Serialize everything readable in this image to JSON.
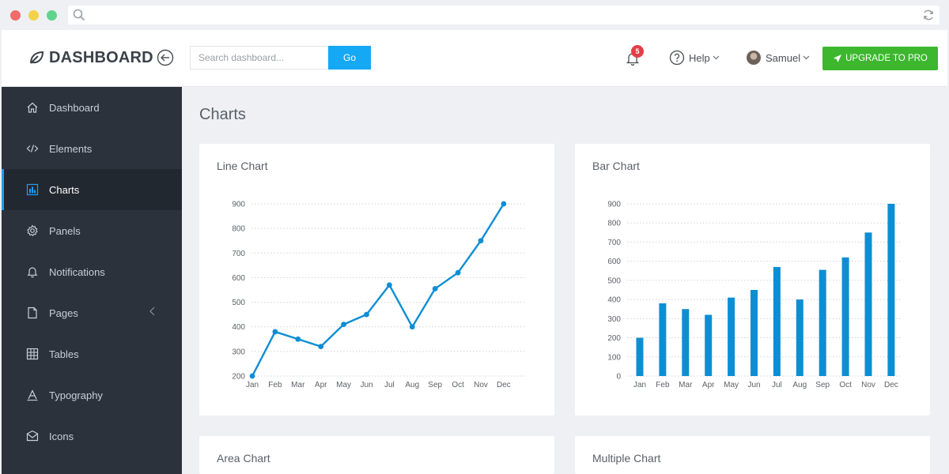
{
  "browser": {
    "icons": {
      "search": "search-icon",
      "reload": "reload-icon"
    }
  },
  "header": {
    "brand": "DASHBOARD",
    "search_placeholder": "Search dashboard...",
    "go_label": "Go",
    "notification_count": "5",
    "help_label": "Help",
    "user_name": "Samuel",
    "upgrade_label": "UPGRADE TO PRO"
  },
  "sidebar": {
    "items": [
      {
        "label": "Dashboard",
        "icon": "home-icon"
      },
      {
        "label": "Elements",
        "icon": "code-icon"
      },
      {
        "label": "Charts",
        "icon": "bar-chart-icon",
        "active": true
      },
      {
        "label": "Panels",
        "icon": "gear-icon"
      },
      {
        "label": "Notifications",
        "icon": "bell-icon"
      },
      {
        "label": "Pages",
        "icon": "file-icon"
      },
      {
        "label": "Tables",
        "icon": "table-icon"
      },
      {
        "label": "Typography",
        "icon": "font-icon"
      },
      {
        "label": "Icons",
        "icon": "envelope-icon"
      }
    ]
  },
  "main": {
    "page_title": "Charts",
    "cards": [
      {
        "title": "Line Chart"
      },
      {
        "title": "Bar Chart"
      },
      {
        "title": "Area Chart"
      },
      {
        "title": "Multiple Chart"
      }
    ]
  },
  "colors": {
    "accent": "#1e9ef0",
    "chart": "#0d8ed4",
    "upgrade": "#3cb72e",
    "sidebar": "#2b323c"
  },
  "chart_data": [
    {
      "type": "line",
      "title": "Line Chart",
      "categories": [
        "Jan",
        "Feb",
        "Mar",
        "Apr",
        "May",
        "Jun",
        "Jul",
        "Aug",
        "Sep",
        "Oct",
        "Nov",
        "Dec"
      ],
      "values": [
        200,
        380,
        350,
        320,
        410,
        450,
        570,
        400,
        555,
        620,
        750,
        900
      ],
      "ylim": [
        200,
        900
      ],
      "yticks": [
        "200",
        "300",
        "400",
        "500",
        "600",
        "700",
        "800",
        "900"
      ],
      "grid": true
    },
    {
      "type": "bar",
      "title": "Bar Chart",
      "categories": [
        "Jan",
        "Feb",
        "Mar",
        "Apr",
        "May",
        "Jun",
        "Jul",
        "Aug",
        "Sep",
        "Oct",
        "Nov",
        "Dec"
      ],
      "values": [
        200,
        380,
        350,
        320,
        410,
        450,
        570,
        400,
        555,
        620,
        750,
        900
      ],
      "ylim": [
        0,
        900
      ],
      "yticks": [
        "0",
        "100",
        "200",
        "300",
        "400",
        "500",
        "600",
        "700",
        "800",
        "900"
      ],
      "grid": true
    }
  ]
}
